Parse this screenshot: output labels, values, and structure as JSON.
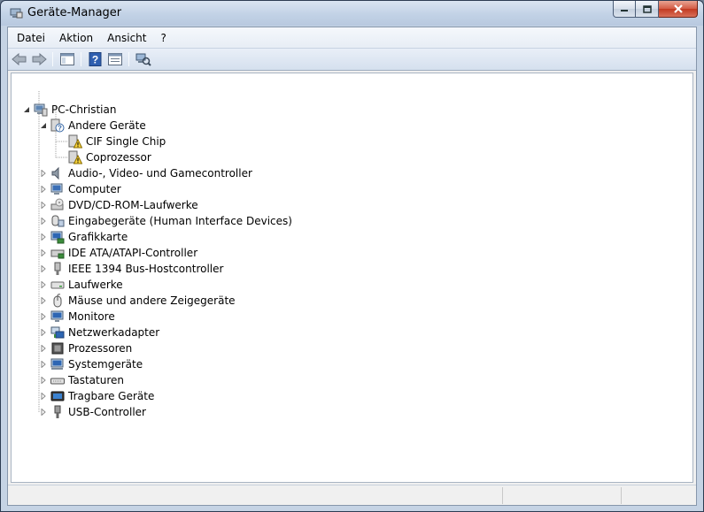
{
  "window": {
    "title": "Geräte-Manager"
  },
  "menu": [
    "Datei",
    "Aktion",
    "Ansicht",
    "?"
  ],
  "toolbar": {
    "buttons": [
      "back-icon",
      "forward-icon",
      "show-hide-console-tree-icon",
      "help-icon",
      "properties-icon",
      "scan-hardware-icon"
    ]
  },
  "tree": {
    "root": "PC-Christian",
    "other_devices": {
      "label": "Andere Geräte",
      "children": [
        "CIF Single Chip",
        "Coprozessor"
      ]
    },
    "categories": [
      {
        "label": "Audio-, Video- und Gamecontroller",
        "icon": "speaker-icon"
      },
      {
        "label": "Computer",
        "icon": "computer-icon"
      },
      {
        "label": "DVD/CD-ROM-Laufwerke",
        "icon": "dvd-drive-icon"
      },
      {
        "label": "Eingabegeräte (Human Interface Devices)",
        "icon": "hid-icon"
      },
      {
        "label": "Grafikkarte",
        "icon": "display-adapter-icon"
      },
      {
        "label": "IDE ATA/ATAPI-Controller",
        "icon": "ide-controller-icon"
      },
      {
        "label": "IEEE 1394 Bus-Hostcontroller",
        "icon": "firewire-icon"
      },
      {
        "label": "Laufwerke",
        "icon": "disk-drive-icon"
      },
      {
        "label": "Mäuse und andere Zeigegeräte",
        "icon": "mouse-icon"
      },
      {
        "label": "Monitore",
        "icon": "monitor-icon"
      },
      {
        "label": "Netzwerkadapter",
        "icon": "network-adapter-icon"
      },
      {
        "label": "Prozessoren",
        "icon": "processor-icon"
      },
      {
        "label": "Systemgeräte",
        "icon": "system-devices-icon"
      },
      {
        "label": "Tastaturen",
        "icon": "keyboard-icon"
      },
      {
        "label": "Tragbare Geräte",
        "icon": "portable-device-icon"
      },
      {
        "label": "USB-Controller",
        "icon": "usb-icon"
      }
    ]
  }
}
